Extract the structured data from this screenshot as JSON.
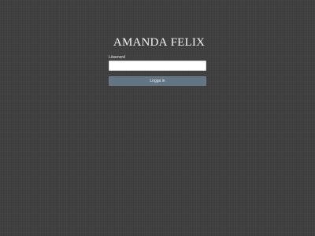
{
  "brand": {
    "first": "AMANDA",
    "second": "FELIX"
  },
  "form": {
    "password_label": "Lösenord",
    "password_value": "",
    "login_button": "Logga in"
  },
  "colors": {
    "background": "#404040",
    "button": "#637483",
    "input_background": "#ffffff",
    "text": "#f2f2f2"
  }
}
